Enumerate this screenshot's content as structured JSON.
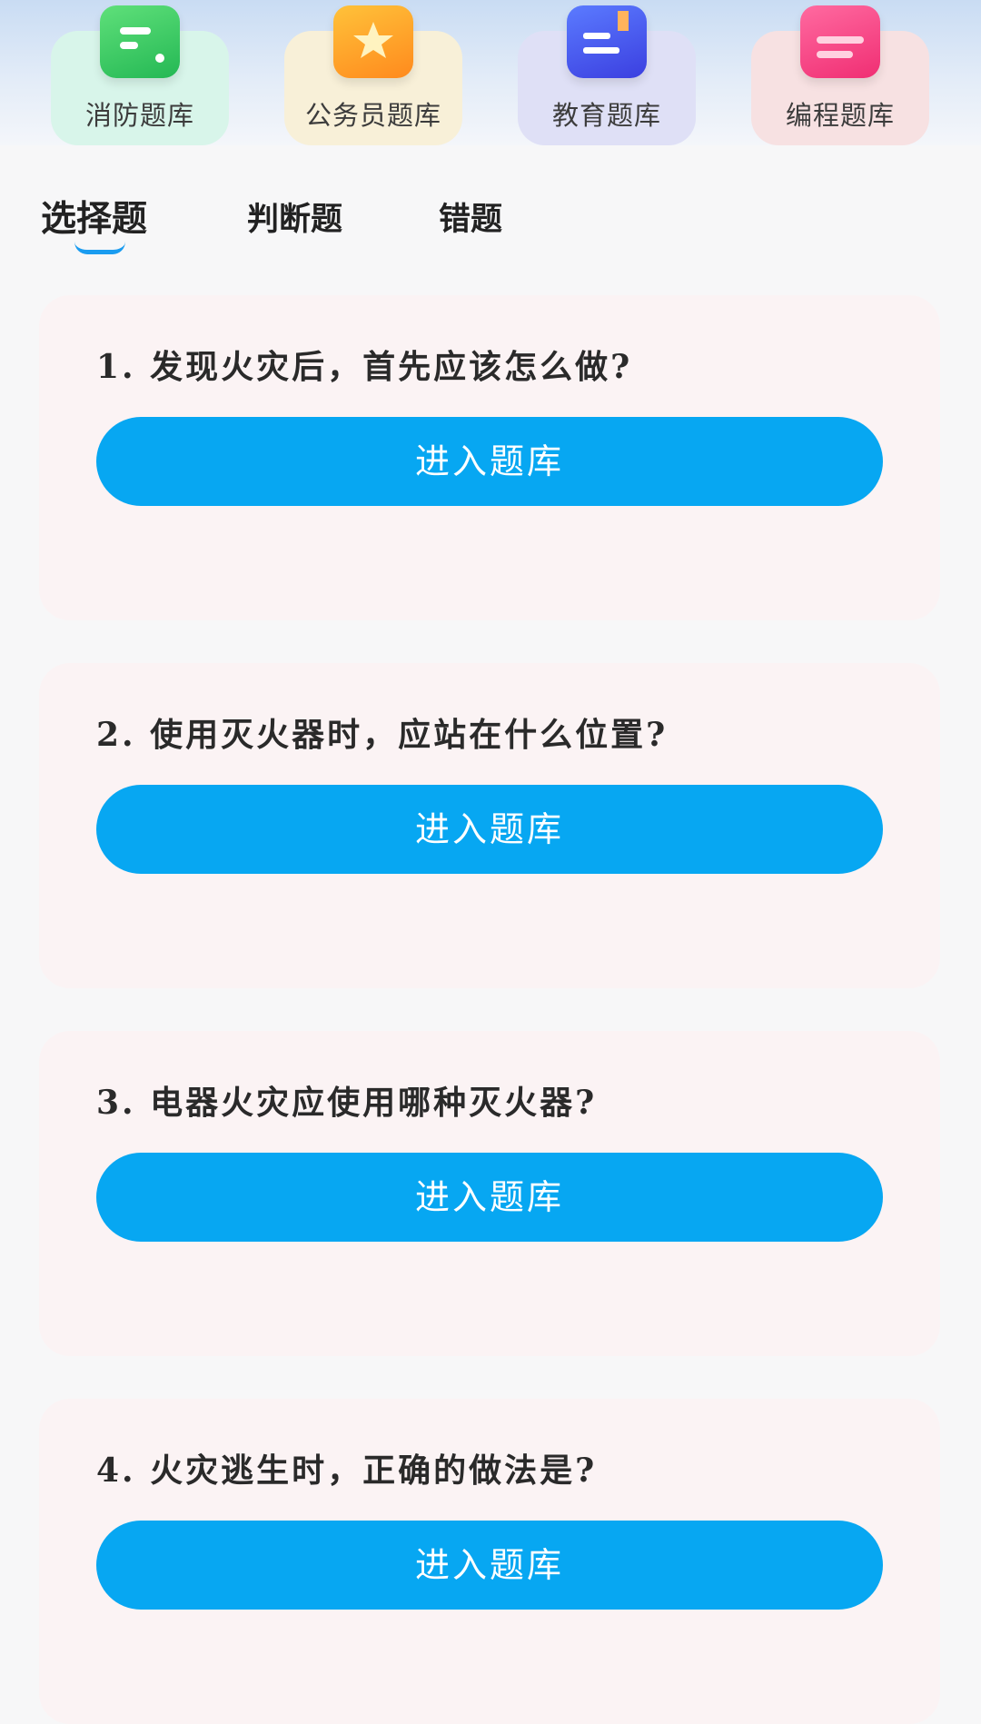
{
  "categories": [
    {
      "label": "消防题库",
      "icon": "fire-bank-icon"
    },
    {
      "label": "公务员题库",
      "icon": "star-icon"
    },
    {
      "label": "教育题库",
      "icon": "book-icon"
    },
    {
      "label": "编程题库",
      "icon": "code-list-icon"
    }
  ],
  "tabs": [
    {
      "label": "选择题",
      "active": true
    },
    {
      "label": "判断题",
      "active": false
    },
    {
      "label": "错题",
      "active": false
    }
  ],
  "questions": [
    {
      "text": "1. 发现火灾后，首先应该怎么做?",
      "button": "进入题库"
    },
    {
      "text": "2. 使用灭火器时，应站在什么位置?",
      "button": "进入题库"
    },
    {
      "text": "3. 电器火灾应使用哪种灭火器?",
      "button": "进入题库"
    },
    {
      "text": "4. 火灾逃生时，正确的做法是?",
      "button": "进入题库"
    }
  ],
  "colors": {
    "accent": "#07a7f2",
    "card_bg": "#fbf3f4"
  }
}
